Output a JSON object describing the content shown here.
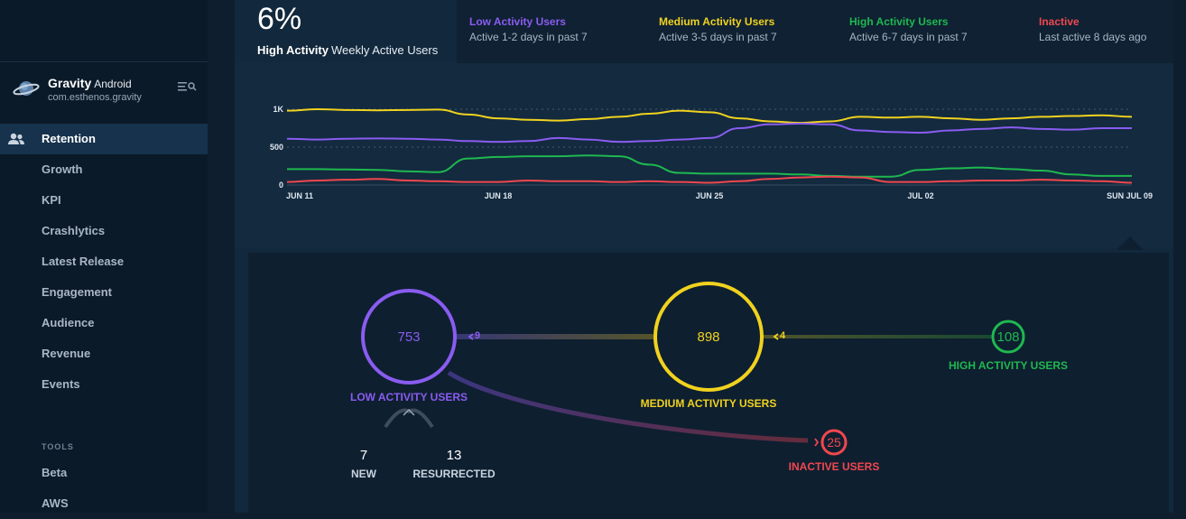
{
  "app": {
    "name": "Gravity",
    "platform": "Android",
    "package": "com.esthenos.gravity"
  },
  "nav": {
    "items": [
      {
        "label": "Retention",
        "active": true
      },
      {
        "label": "Growth"
      },
      {
        "label": "KPI"
      },
      {
        "label": "Crashlytics"
      },
      {
        "label": "Latest Release"
      },
      {
        "label": "Engagement"
      },
      {
        "label": "Audience"
      },
      {
        "label": "Revenue"
      },
      {
        "label": "Events"
      }
    ],
    "tools_label": "TOOLS",
    "tools": [
      {
        "label": "Beta"
      },
      {
        "label": "AWS"
      }
    ]
  },
  "summary": {
    "value": "6%",
    "label_bold": "High Activity",
    "label": "Weekly Active Users"
  },
  "legend": [
    {
      "title": "Low Activity Users",
      "desc": "Active 1-2 days in past 7",
      "color": "#8a5cf0"
    },
    {
      "title": "Medium Activity Users",
      "desc": "Active 3-5 days in past 7",
      "color": "#f0d21e"
    },
    {
      "title": "High Activity Users",
      "desc": "Active 6-7 days in past 7",
      "color": "#1fb84f"
    },
    {
      "title": "Inactive",
      "desc": "Last active 8 days ago",
      "color": "#f0474e"
    }
  ],
  "chart_data": {
    "type": "line",
    "ylim": [
      0,
      1200
    ],
    "y_ticks": [
      "0",
      "500",
      "1K"
    ],
    "x_ticks": [
      "JUN 11",
      "JUN 18",
      "JUN 25",
      "JUL 02",
      "SUN JUL 09"
    ],
    "x": [
      "Jun 11",
      "Jun 12",
      "Jun 13",
      "Jun 14",
      "Jun 15",
      "Jun 16",
      "Jun 17",
      "Jun 18",
      "Jun 19",
      "Jun 20",
      "Jun 21",
      "Jun 22",
      "Jun 23",
      "Jun 24",
      "Jun 25",
      "Jun 26",
      "Jun 27",
      "Jun 28",
      "Jun 29",
      "Jun 30",
      "Jul 01",
      "Jul 02",
      "Jul 03",
      "Jul 04",
      "Jul 05",
      "Jul 06",
      "Jul 07",
      "Jul 08",
      "Jul 09"
    ],
    "series": [
      {
        "name": "Medium Activity Users",
        "color": "#f0d21e",
        "values": [
          980,
          1000,
          990,
          985,
          990,
          995,
          930,
          880,
          860,
          850,
          870,
          900,
          940,
          980,
          960,
          880,
          840,
          820,
          840,
          900,
          890,
          900,
          880,
          860,
          880,
          900,
          910,
          920,
          900
        ]
      },
      {
        "name": "Low Activity Users",
        "color": "#8a5cf0",
        "values": [
          610,
          600,
          610,
          615,
          610,
          600,
          580,
          570,
          580,
          620,
          600,
          570,
          580,
          600,
          620,
          750,
          800,
          810,
          800,
          720,
          700,
          690,
          720,
          740,
          760,
          740,
          730,
          750,
          750
        ]
      },
      {
        "name": "High Activity Users",
        "color": "#1fb84f",
        "values": [
          210,
          210,
          205,
          200,
          180,
          170,
          350,
          370,
          380,
          380,
          390,
          380,
          270,
          160,
          150,
          150,
          150,
          140,
          120,
          110,
          110,
          200,
          220,
          230,
          210,
          190,
          140,
          120,
          120
        ]
      },
      {
        "name": "Inactive",
        "color": "#f0474e",
        "values": [
          40,
          60,
          70,
          80,
          60,
          50,
          40,
          40,
          60,
          50,
          50,
          40,
          50,
          40,
          30,
          50,
          80,
          100,
          110,
          100,
          40,
          40,
          50,
          60,
          60,
          70,
          60,
          50,
          30
        ]
      }
    ]
  },
  "flow": {
    "low": {
      "value": "753",
      "label": "LOW ACTIVITY USERS"
    },
    "medium": {
      "value": "898",
      "label": "MEDIUM ACTIVITY USERS"
    },
    "high": {
      "value": "108",
      "label": "HIGH ACTIVITY USERS"
    },
    "inactive": {
      "value": "25",
      "label": "INACTIVE USERS"
    },
    "medium_to_low": "9",
    "high_to_medium": "4",
    "new": {
      "value": "7",
      "label": "NEW"
    },
    "resurrected": {
      "value": "13",
      "label": "RESURRECTED"
    }
  }
}
